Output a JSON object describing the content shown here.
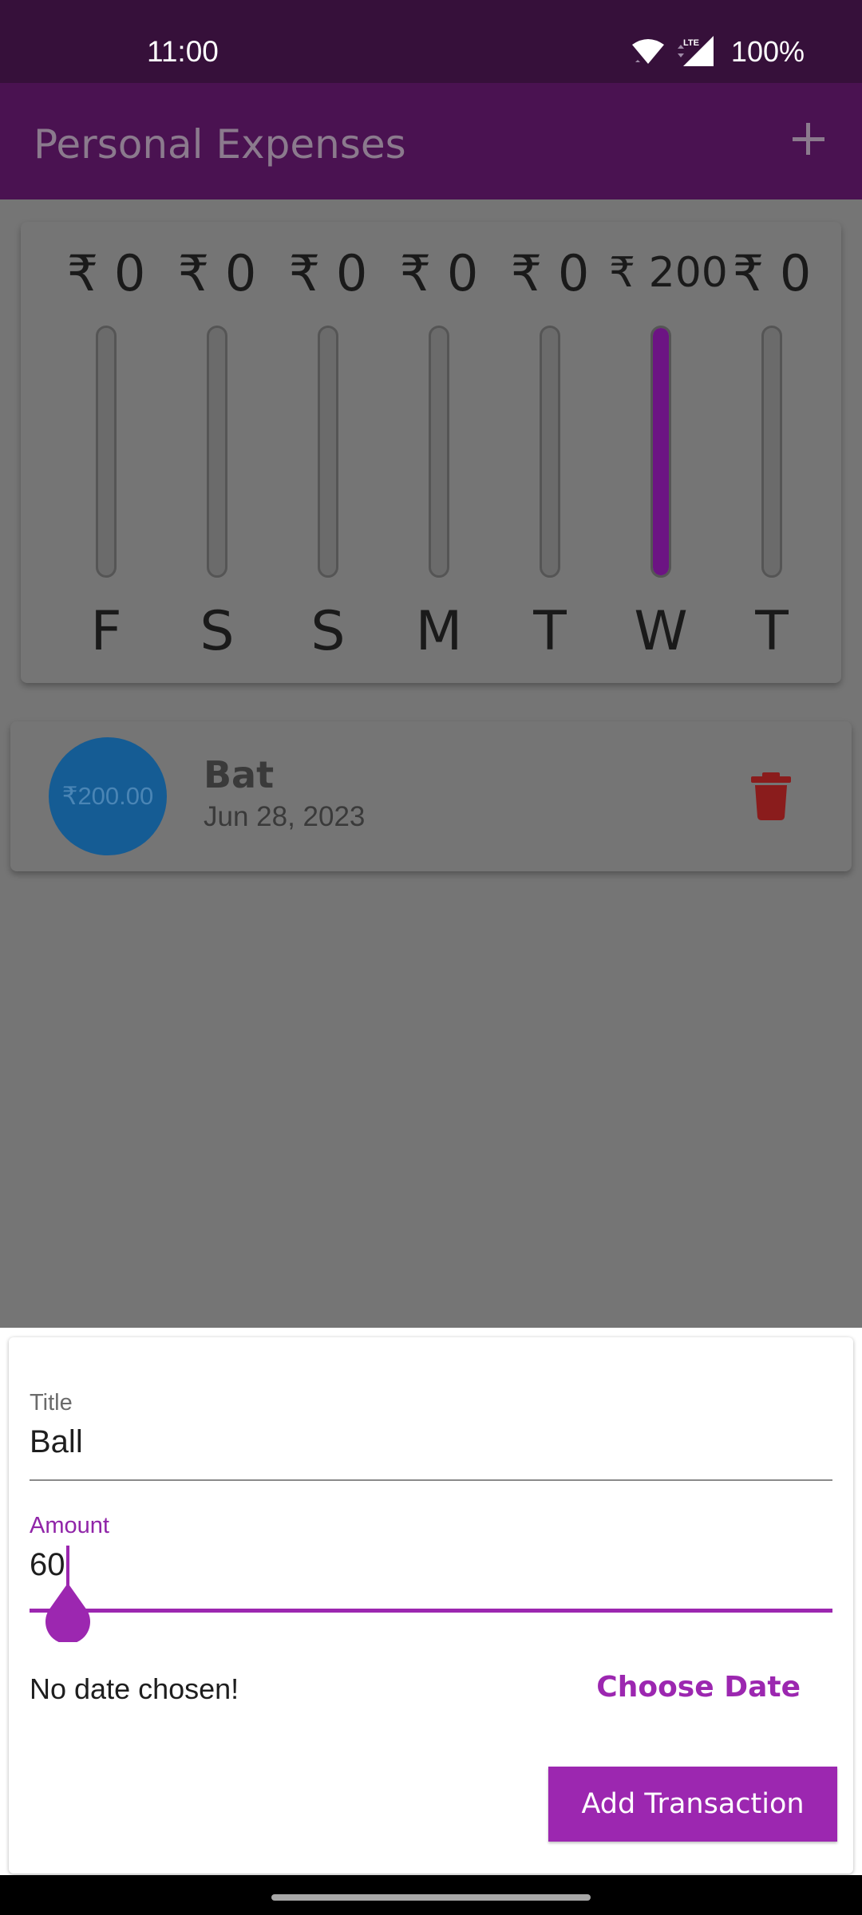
{
  "status_bar": {
    "time": "11:00",
    "battery": "100%",
    "icons": [
      "wifi-icon",
      "lte-signal-icon"
    ]
  },
  "app_bar": {
    "title": "Personal Expenses",
    "add_icon": "plus-icon"
  },
  "chart_data": {
    "type": "bar",
    "categories": [
      "F",
      "S",
      "S",
      "M",
      "T",
      "W",
      "T"
    ],
    "amount_labels": [
      "₹ 0",
      "₹ 0",
      "₹ 0",
      "₹ 0",
      "₹ 0",
      "₹ 200",
      "₹ 0"
    ],
    "values": [
      0,
      0,
      0,
      0,
      0,
      200,
      0
    ],
    "share_of_week_total": [
      0,
      0,
      0,
      0,
      0,
      1.0,
      0
    ],
    "colors": {
      "fill": "#6c1483",
      "track": "#6b6b6b"
    }
  },
  "transactions": [
    {
      "amount": "₹200.00",
      "title": "Bat",
      "date": "Jun 28, 2023",
      "delete_icon": "trash-icon"
    }
  ],
  "form": {
    "title_label": "Title",
    "title_value": "Ball",
    "amount_label": "Amount",
    "amount_value": "60",
    "date_status": "No date chosen!",
    "choose_date_label": "Choose Date",
    "submit_label": "Add Transaction",
    "accent_color": "#9c27b0"
  }
}
